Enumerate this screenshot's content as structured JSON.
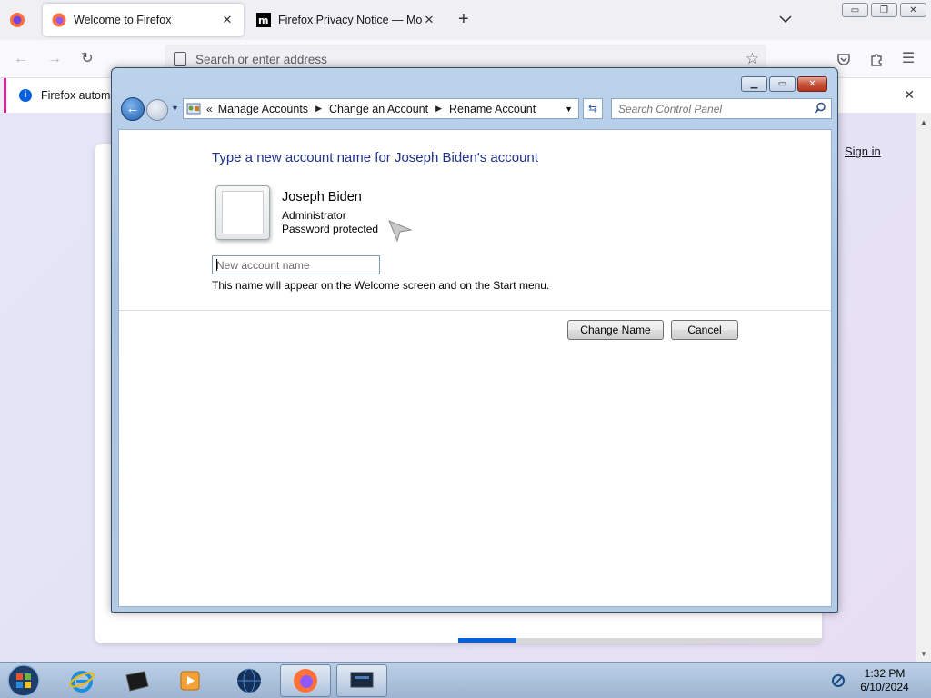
{
  "browser": {
    "tabs": [
      {
        "title": "Welcome to Firefox",
        "active": true
      },
      {
        "title": "Firefox Privacy Notice — Mozill",
        "active": false
      }
    ],
    "urlbar": {
      "placeholder": "Search or enter address"
    },
    "notification": {
      "text": "Firefox automa"
    },
    "page": {
      "sign_in": "Sign in",
      "progress": 0.16
    }
  },
  "dialog": {
    "breadcrumbs": {
      "lead": "«",
      "items": [
        "Manage Accounts",
        "Change an Account",
        "Rename Account"
      ]
    },
    "search": {
      "placeholder": "Search Control Panel"
    },
    "heading": "Type a new account name for Joseph Biden's account",
    "account": {
      "name": "Joseph Biden",
      "role": "Administrator",
      "status": "Password protected"
    },
    "input": {
      "placeholder": "New account name",
      "value": ""
    },
    "hint": "This name will appear on the Welcome screen and on the Start menu.",
    "buttons": {
      "change": "Change Name",
      "cancel": "Cancel"
    }
  },
  "taskbar": {
    "items": [
      "start-orb",
      "internet-explorer",
      "terminal",
      "media-player",
      "globe",
      "firefox",
      "screen-app"
    ],
    "clock": {
      "time": "1:32 PM",
      "date": "6/10/2024"
    }
  },
  "colors": {
    "heading": "#1e3287",
    "accent_pink": "#e01b9d",
    "progress_blue": "#0061e0"
  }
}
